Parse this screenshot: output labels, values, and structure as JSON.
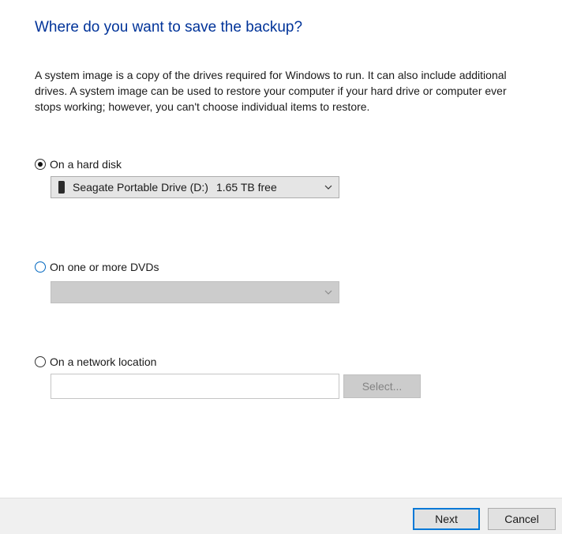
{
  "page": {
    "title": "Where do you want to save the backup?",
    "description": "A system image is a copy of the drives required for Windows to run. It can also include additional drives. A system image can be used to restore your computer if your hard drive or computer ever stops working; however, you can't choose individual items to restore."
  },
  "options": {
    "hard_disk": {
      "label": "On a hard disk",
      "checked": true,
      "drive": {
        "name": "Seagate Portable Drive (D:)",
        "free": "1.65 TB free",
        "icon": "drive-icon"
      }
    },
    "dvds": {
      "label": "On one or more DVDs",
      "checked": false,
      "selected_value": ""
    },
    "network": {
      "label": "On a network location",
      "checked": false,
      "path_value": "",
      "select_label": "Select..."
    }
  },
  "footer": {
    "next_label": "Next",
    "cancel_label": "Cancel"
  },
  "colors": {
    "title": "#003399",
    "accent": "#0078d7",
    "footer_bg": "#f0f0f0"
  }
}
